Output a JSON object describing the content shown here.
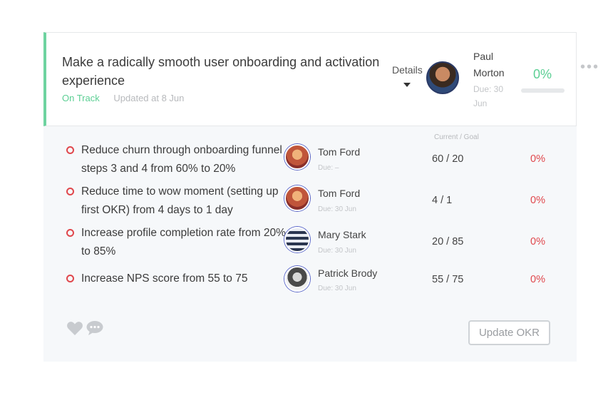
{
  "objective": {
    "title": "Make a radically smooth user onboarding and activation experience",
    "status": "On Track",
    "updated": "Updated at 8 Jun",
    "details_label": "Details",
    "owner_name": "Paul Morton",
    "owner_due": "Due: 30 Jun",
    "progress_label": "0%",
    "progress": 0,
    "status_color": "#5ccf94"
  },
  "key_results": {
    "header": "Current / Goal",
    "items": [
      {
        "text": "Reduce churn through onboarding funnel steps 3 and 4 from 60% to 20%",
        "owner": "Tom Ford",
        "due": "Due: –",
        "current_goal": "60 / 20",
        "progress": "0%"
      },
      {
        "text": "Reduce time to wow moment (setting up first OKR) from 4 days to 1 day",
        "owner": "Tom Ford",
        "due": "Due: 30 Jun",
        "current_goal": "4 / 1",
        "progress": "0%"
      },
      {
        "text": "Increase profile completion rate from 20% to 85%",
        "owner": "Mary Stark",
        "due": "Due: 30 Jun",
        "current_goal": "20 / 85",
        "progress": "0%"
      },
      {
        "text": "Increase NPS score from 55 to 75",
        "owner": "Patrick Brody",
        "due": "Due: 30 Jun",
        "current_goal": "55 / 75",
        "progress": "0%"
      }
    ],
    "bullet_color": "#e0474c"
  },
  "footer": {
    "update_button": "Update OKR",
    "like_icon": "heart-icon",
    "comment_icon": "comment-icon"
  }
}
